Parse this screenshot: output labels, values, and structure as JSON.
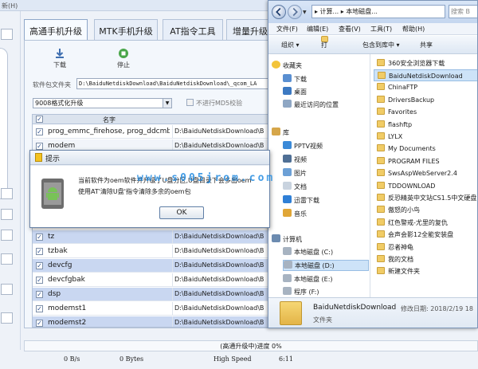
{
  "tool": {
    "title_fragment": "新(H)",
    "tabs": [
      "高通手机升级",
      "MTK手机升级",
      "AT指令工具",
      "增量升级"
    ],
    "toolbar": {
      "download_label": "下载",
      "stop_label": "停止"
    },
    "package_label": "软件包文件夹",
    "package_path": "D:\\BaiduNetdiskDownload\\BaiduNetdiskDownload\\_qcom_LA",
    "format_select": "9008格式化升级",
    "md5_label": "不进行MD5校验",
    "table": {
      "header_name": "名字",
      "rows": [
        {
          "name": "prog_emmc_firehose, prog_ddcmbn",
          "path": "D:\\BaiduNetdiskDownload\\B",
          "checked": true
        },
        {
          "name": "modem",
          "path": "D:\\BaiduNetdiskDownload\\B",
          "checked": true
        },
        {
          "name": "tz",
          "path": "D:\\BaiduNetdiskDownload\\B",
          "checked": true
        },
        {
          "name": "tzbak",
          "path": "D:\\BaiduNetdiskDownload\\B",
          "checked": true
        },
        {
          "name": "devcfg",
          "path": "D:\\BaiduNetdiskDownload\\B",
          "checked": true
        },
        {
          "name": "devcfgbak",
          "path": "D:\\BaiduNetdiskDownload\\B",
          "checked": true
        },
        {
          "name": "dsp",
          "path": "D:\\BaiduNetdiskDownload\\B",
          "checked": true
        },
        {
          "name": "modemst1",
          "path": "D:\\BaiduNetdiskDownload\\B",
          "checked": true
        },
        {
          "name": "modemst2",
          "path": "D:\\BaiduNetdiskDownload\\B",
          "checked": true
        }
      ]
    },
    "progress_text": "(高通升级中)进度 0%",
    "progress_percent": 0,
    "status": {
      "speed": "0 B/s",
      "bytes": "0 Bytes",
      "mode": "High Speed",
      "time": "6:11"
    }
  },
  "explorer": {
    "address": "▸ 计算... ▸ 本地磁盘...",
    "search_placeholder": "搜索 B",
    "menu": [
      "文件(F)",
      "编辑(E)",
      "查看(V)",
      "工具(T)",
      "帮助(H)"
    ],
    "commands": [
      "组织 ▾",
      "打开",
      "包含到库中 ▾",
      "共享"
    ],
    "nav": {
      "favorites": "收藏夹",
      "favorites_items": [
        "下载",
        "桌面",
        "最近访问的位置"
      ],
      "libraries": "库",
      "library_items": [
        "PPTV视频",
        "视频",
        "图片",
        "文档",
        "迅雷下载",
        "音乐"
      ],
      "computer": "计算机",
      "drives": [
        "本地磁盘 (C:)",
        "本地磁盘 (D:)",
        "本地磁盘 (E:)",
        "程序 (F:)"
      ]
    },
    "files": [
      "360安全浏览器下载",
      "BaiduNetdiskDownload",
      "ChinaFTP",
      "DriversBackup",
      "Favorites",
      "flashftp",
      "LYLX",
      "My Documents",
      "PROGRAM FILES",
      "SwsAspWebServer2.4",
      "TDDOWNLOAD",
      "反恐精英中文站CS1.5中文硬盘",
      "傲怒的小鸟",
      "红色警戒-尤里的复仇",
      "会声会影12全能安装盘",
      "忍者神龟",
      "我的文档",
      "新建文件夹"
    ],
    "selected_file_index": 1,
    "details": {
      "name": "BaiduNetdiskDownload",
      "modified": "修改日期: 2018/2/19 18",
      "type": "文件夹"
    }
  },
  "dialog": {
    "title": "提示",
    "message_line1": "当前软件为oem软件并升级了U盘分区,U盘目录下会多出oem",
    "message_line2": "使用AT'清除U盘'指令清除多余的oem包",
    "ok_label": "OK"
  },
  "watermark": "www.s005jrom.com",
  "colors": {
    "selection": "#cde3f8",
    "watermark": "#248ce1",
    "warning_icon": "#f4c21f",
    "android_green": "#78c257"
  }
}
